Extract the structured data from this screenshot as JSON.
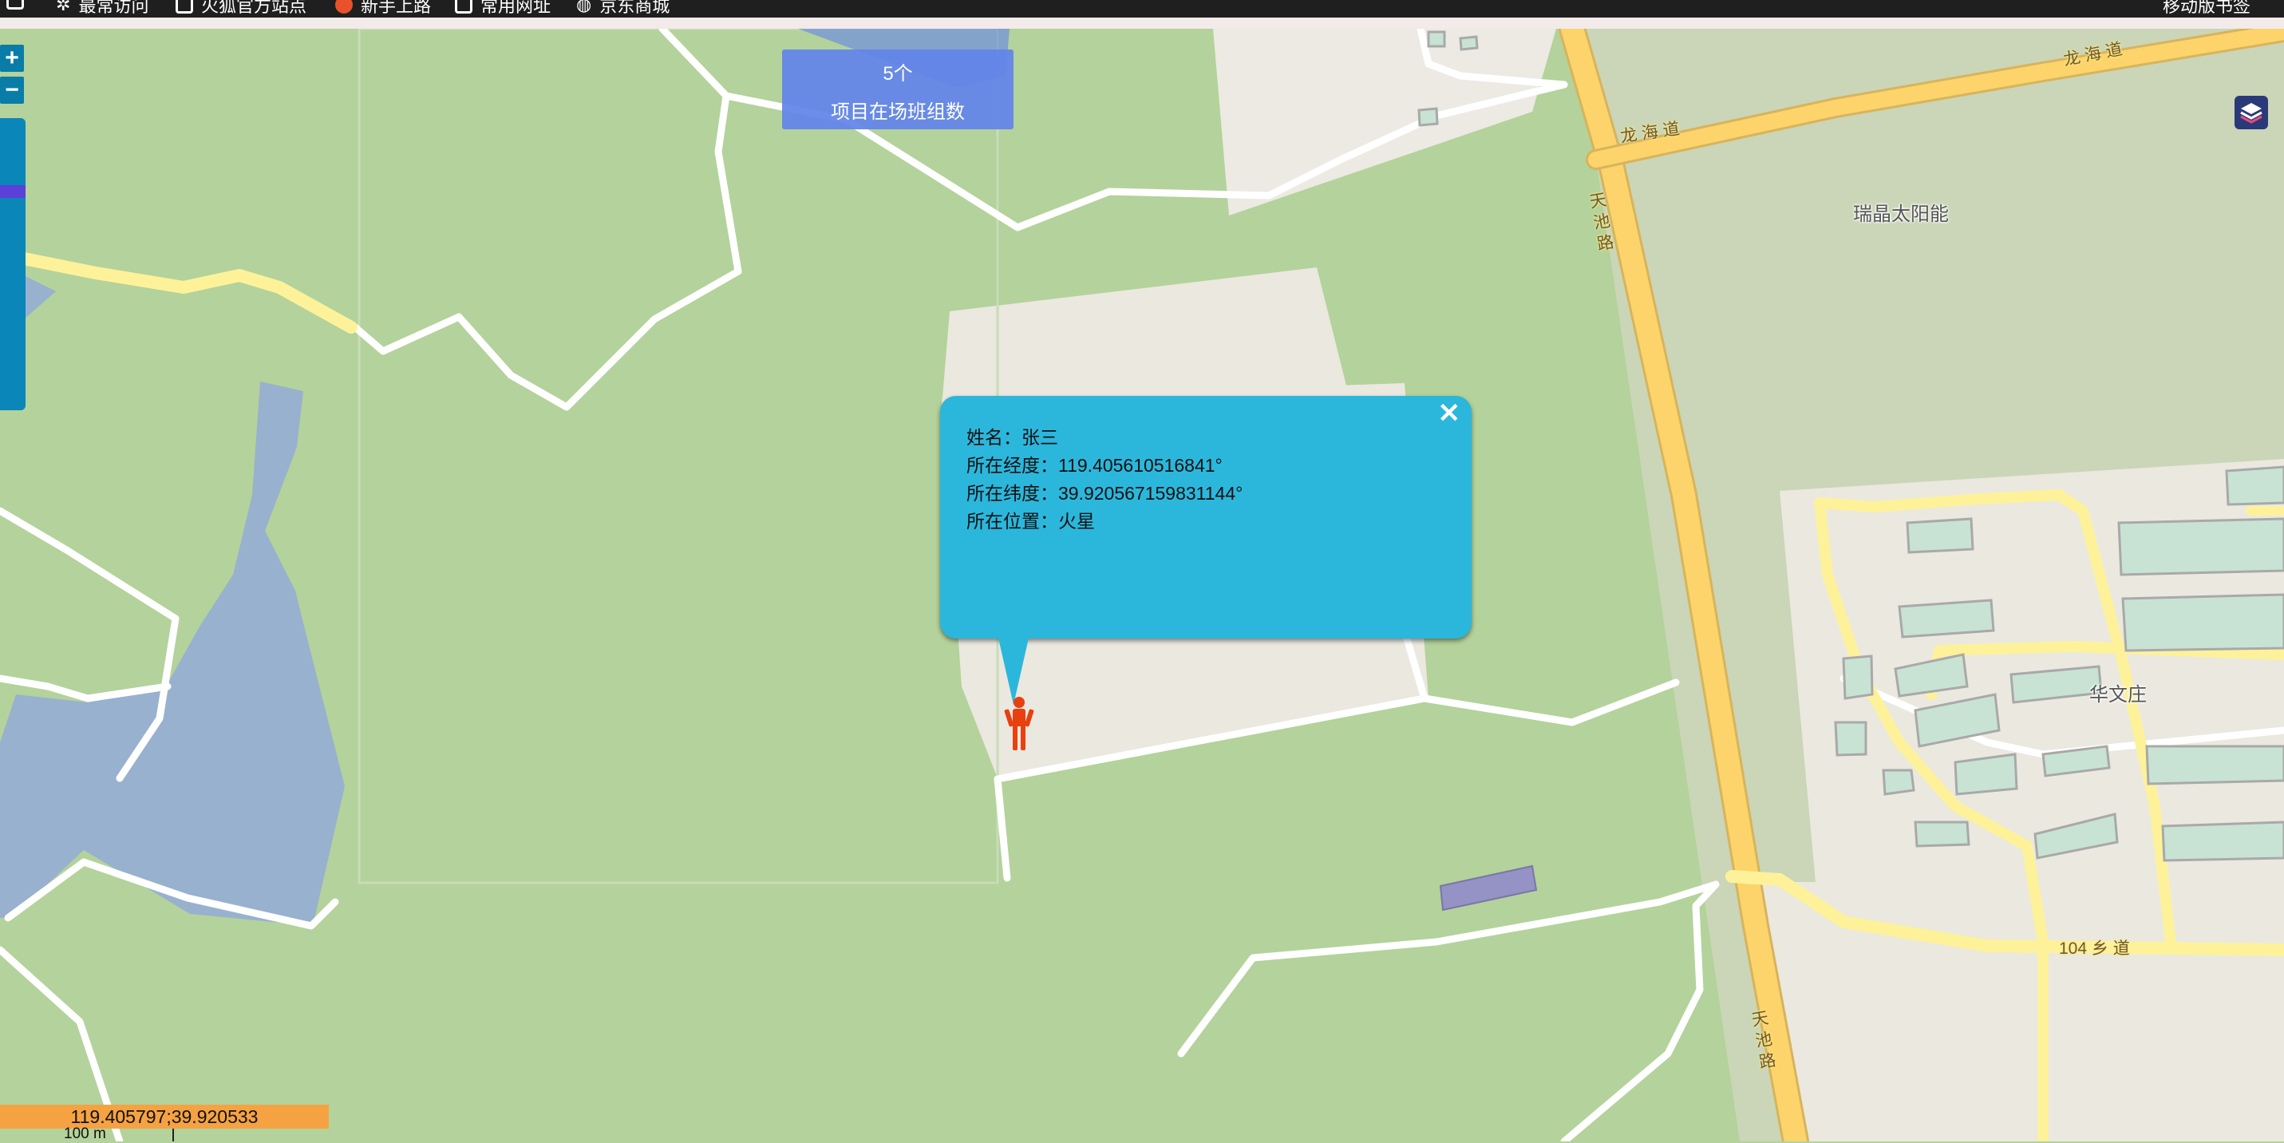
{
  "browser_bar": {
    "items": [
      "最常访问",
      "火狐官方站点",
      "新手上路",
      "常用网址",
      "京东商城"
    ],
    "right_label": "移动版书签"
  },
  "map": {
    "labels": {
      "road_longhai_1": "龙 海 道",
      "road_longhai_2": "龙 海 道",
      "road_tianchi_1": "天 池 路",
      "road_tianchi_2": "天 池 路",
      "road_104": "104 乡 道",
      "place_solar": "瑞晶太阳能",
      "place_huawen": "华文庄"
    }
  },
  "controls": {
    "zoom_in": "+",
    "zoom_out": "−",
    "layer_icon": "layers-icon"
  },
  "stat": {
    "count": "5个",
    "label": "项目在场班组数"
  },
  "popup": {
    "close": "✕",
    "name_line": "姓名：张三",
    "lon_line": "所在经度：119.405610516841°",
    "lat_line": "所在纬度：39.920567159831144°",
    "loc_line": "所在位置：火星"
  },
  "status": {
    "coordinates": "119.405797;39.920533",
    "scale": "100 m"
  },
  "colors": {
    "water": "#98b1cf",
    "grass": "#b4d29b",
    "popup": "#2bb7dc",
    "stat_box": "#6284ea",
    "road_major": "#fcd46b",
    "coord_bar": "#f5a243"
  }
}
